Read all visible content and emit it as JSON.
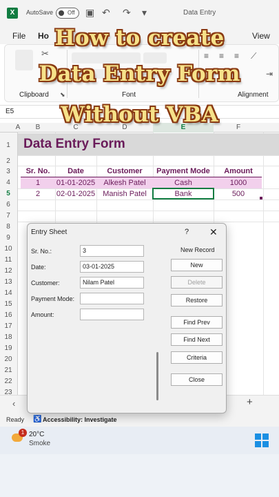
{
  "titlebar": {
    "app_badge": "X",
    "autosave_label": "AutoSave",
    "autosave_state": "Off",
    "document_title": "Data Entry"
  },
  "ribbon": {
    "tabs": [
      "File",
      "Ho",
      "View"
    ],
    "groups": [
      "Clipboard",
      "Font",
      "Alignment"
    ]
  },
  "namebox": "E5",
  "columns": [
    "A",
    "B",
    "C",
    "D",
    "E",
    "F"
  ],
  "rows": [
    "1",
    "2",
    "3",
    "4",
    "5",
    "6",
    "7",
    "8",
    "9",
    "10",
    "11",
    "12",
    "13",
    "14",
    "15",
    "16",
    "17",
    "18",
    "19",
    "20",
    "21",
    "22",
    "23"
  ],
  "sheet": {
    "title": "Data Entry Form",
    "headers": [
      "Sr. No.",
      "Date",
      "Customer",
      "Payment Mode",
      "Amount"
    ],
    "records": [
      [
        "1",
        "01-01-2025",
        "Alkesh Patel",
        "Cash",
        "1000"
      ],
      [
        "2",
        "02-01-2025",
        "Manish Patel",
        "Bank",
        "500"
      ]
    ]
  },
  "dialog": {
    "title": "Entry Sheet",
    "help": "?",
    "close": "✕",
    "record_status": "New Record",
    "fields": [
      {
        "label": "Sr. No.:",
        "value": "3"
      },
      {
        "label": "Date:",
        "value": "03-01-2025"
      },
      {
        "label": "Customer:",
        "value": "Nilam Patel"
      },
      {
        "label": "Payment Mode:",
        "value": ""
      },
      {
        "label": "Amount:",
        "value": ""
      }
    ],
    "buttons": {
      "new": "New",
      "delete": "Delete",
      "restore": "Restore",
      "find_prev": "Find Prev",
      "find_next": "Find Next",
      "criteria": "Criteria",
      "close": "Close"
    }
  },
  "status": {
    "ready": "Ready",
    "accessibility": "Accessibility: Investigate"
  },
  "sheet_tabs": {
    "add": "+",
    "prev": "‹"
  },
  "taskbar": {
    "notification_count": "1",
    "temperature": "20°C",
    "condition": "Smoke"
  },
  "overlay": {
    "line1": "How to create",
    "line2": "Data Entry Form",
    "line3": "Without VBA"
  },
  "colors": {
    "accent_purple": "#6a1b5a",
    "row_highlight": "#f2d0ec",
    "excel_green": "#107c41",
    "headline_fill": "#f6e28a"
  }
}
